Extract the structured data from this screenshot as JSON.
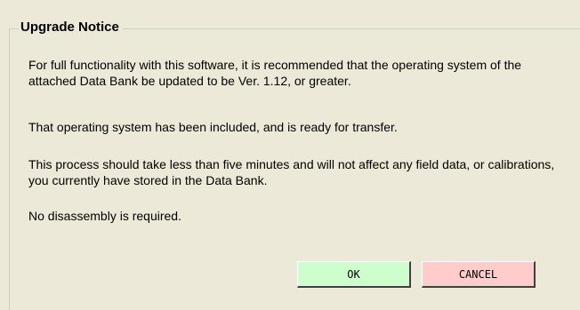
{
  "dialog": {
    "title": "Upgrade Notice",
    "paragraphs": [
      "For full functionality with this software, it is recommended that the operating system of the attached Data Bank be updated to be Ver. 1.12, or greater.",
      "That operating system has been included, and is ready for transfer.",
      "This process should take less than five minutes and will not affect any field data, or calibrations, you currently have stored in the Data Bank.",
      "No disassembly is required."
    ],
    "ok_label": "OK",
    "cancel_label": "CANCEL"
  },
  "colors": {
    "background": "#ece9d8",
    "ok_button": "#ccffcc",
    "cancel_button": "#ffcccc",
    "groupbox_border": "#d0d0bf"
  }
}
